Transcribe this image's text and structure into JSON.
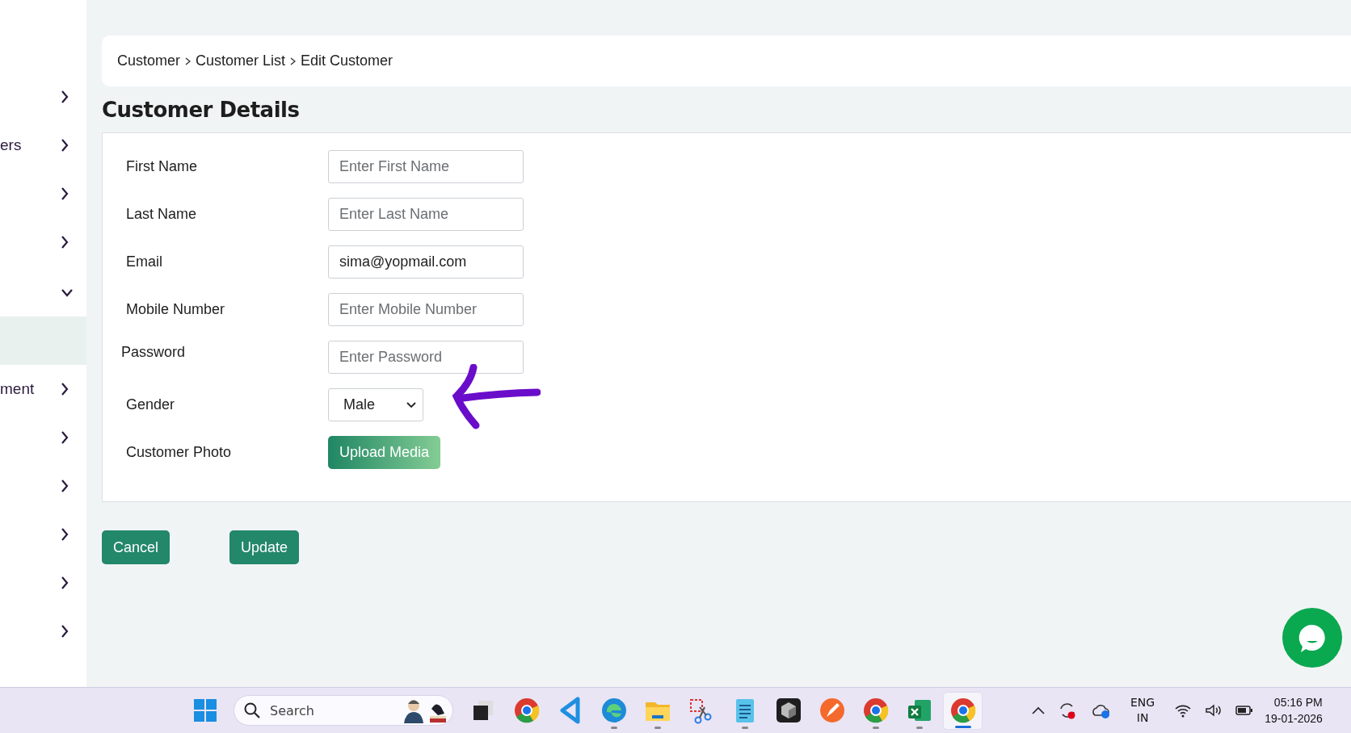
{
  "sidebar": {
    "items": [
      {
        "kind": "group",
        "expanded": false,
        "selected": false
      },
      {
        "kind": "group",
        "label": "ers",
        "expanded": false,
        "selected": false
      },
      {
        "kind": "group",
        "expanded": false,
        "selected": false
      },
      {
        "kind": "group",
        "expanded": false,
        "selected": false
      },
      {
        "kind": "group",
        "expanded": true,
        "selected": false
      },
      {
        "kind": "subitem",
        "expanded": false,
        "selected": true
      },
      {
        "kind": "group",
        "label": "ment",
        "expanded": false,
        "selected": false
      },
      {
        "kind": "group",
        "expanded": false,
        "selected": false
      },
      {
        "kind": "group",
        "expanded": false,
        "selected": false
      },
      {
        "kind": "group",
        "expanded": false,
        "selected": false
      },
      {
        "kind": "group",
        "expanded": false,
        "selected": false
      },
      {
        "kind": "group",
        "expanded": false,
        "selected": false
      }
    ]
  },
  "breadcrumb": [
    "Customer",
    "Customer List",
    "Edit Customer"
  ],
  "title": "Customer Details",
  "form": {
    "fields": [
      {
        "kind": "text",
        "label": "First Name",
        "placeholder": "Enter First Name"
      },
      {
        "kind": "text",
        "label": "Last Name",
        "placeholder": "Enter Last Name"
      },
      {
        "kind": "text",
        "label": "Email",
        "value": "sima@yopmail.com"
      },
      {
        "kind": "text",
        "label": "Mobile Number",
        "placeholder": "Enter Mobile Number"
      },
      {
        "kind": "text",
        "label": "Password",
        "placeholder": "Enter Password"
      },
      {
        "kind": "select",
        "label": "Gender",
        "value": "Male"
      },
      {
        "kind": "upload",
        "label": "Customer Photo",
        "button": "Upload Media"
      }
    ]
  },
  "actions": [
    "Cancel",
    "Update"
  ],
  "taskbar": {
    "search": {
      "placeholder": "Search"
    },
    "apps": [
      {
        "kind": "grid",
        "running": false,
        "active": false
      },
      {
        "kind": "stack",
        "running": false,
        "active": false
      },
      {
        "kind": "browser",
        "running": false,
        "active": false
      },
      {
        "kind": "code",
        "running": false,
        "active": false
      },
      {
        "kind": "wave",
        "running": true,
        "active": false
      },
      {
        "kind": "folder",
        "running": true,
        "active": false
      },
      {
        "kind": "snip",
        "running": false,
        "active": false
      },
      {
        "kind": "notes",
        "running": true,
        "active": false
      },
      {
        "kind": "cube",
        "running": false,
        "active": false
      },
      {
        "kind": "pen",
        "running": false,
        "active": false
      },
      {
        "kind": "browser",
        "running": true,
        "active": false
      },
      {
        "kind": "sheet",
        "running": true,
        "active": false
      },
      {
        "kind": "browser",
        "running": true,
        "active": true
      }
    ],
    "language": [
      "ENG",
      "IN"
    ],
    "time": "05:16 PM",
    "date": "19-01-2026"
  }
}
